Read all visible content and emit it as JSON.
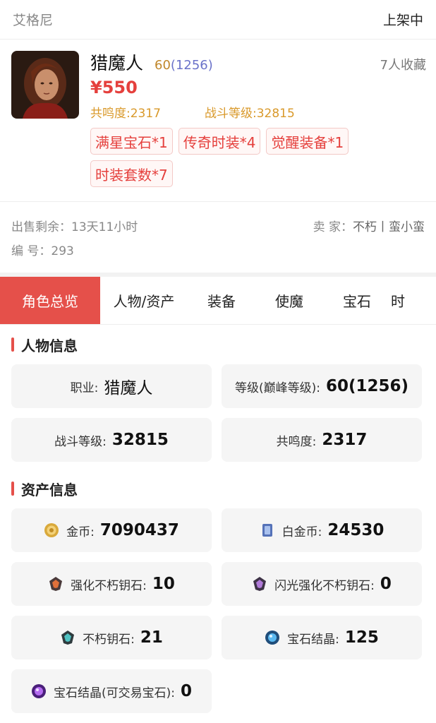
{
  "header": {
    "server": "艾格尼",
    "status": "上架中"
  },
  "listing": {
    "char_name": "猎魔人",
    "level": "60",
    "peak_level": "(1256)",
    "favorites": "7人收藏",
    "price": "¥550",
    "resonance_label": "共鸣度:2317",
    "combat_label": "战斗等级:32815",
    "tags": [
      "满星宝石*1",
      "传奇时装*4",
      "觉醒装备*1",
      "时装套数*7"
    ]
  },
  "meta": {
    "remaining": "出售剩余：13天11小时",
    "seller_label": "卖  家：",
    "seller_name": "不朽丨蛮小蛮",
    "serial": "编  号：293"
  },
  "tabs": [
    "角色总览",
    "人物/资产",
    "装备",
    "使魔",
    "宝石",
    "时"
  ],
  "character_section": {
    "title": "人物信息",
    "items": [
      {
        "label": "职业:",
        "value": "猎魔人"
      },
      {
        "label": "等级(巅峰等级):",
        "value": "60(1256)"
      },
      {
        "label": "战斗等级:",
        "value": "32815"
      },
      {
        "label": "共鸣度:",
        "value": "2317"
      }
    ]
  },
  "asset_section": {
    "title": "资产信息",
    "items": [
      {
        "label": "金币:",
        "value": "7090437",
        "icon": "gold-coin-icon"
      },
      {
        "label": "白金币:",
        "value": "24530",
        "icon": "platinum-card-icon"
      },
      {
        "label": "强化不朽钥石:",
        "value": "10",
        "icon": "enhanced-keystone-icon"
      },
      {
        "label": "闪光强化不朽钥石:",
        "value": "0",
        "icon": "flawless-keystone-icon"
      },
      {
        "label": "不朽钥石:",
        "value": "21",
        "icon": "keystone-icon"
      },
      {
        "label": "宝石结晶:",
        "value": "125",
        "icon": "gem-crystal-icon"
      },
      {
        "label": "宝石结晶(可交易宝石):",
        "value": "0",
        "icon": "tradable-gem-icon"
      }
    ]
  },
  "colors": {
    "accent": "#e5504a",
    "price": "#e5403d",
    "gold_text": "#d9992a"
  }
}
